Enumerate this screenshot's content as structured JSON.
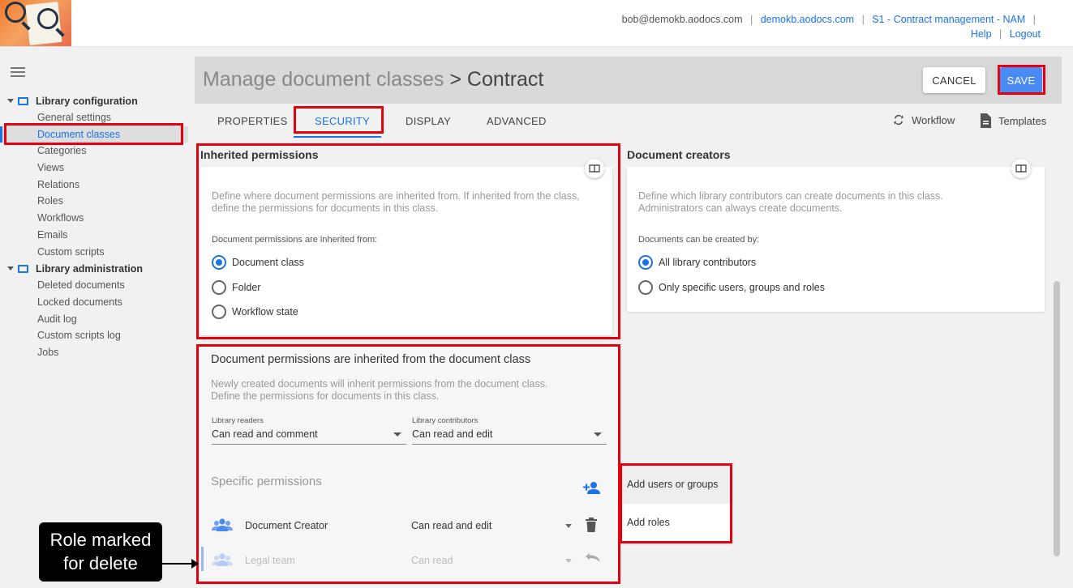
{
  "header": {
    "user_email": "bob@demokb.aodocs.com",
    "domain": "demokb.aodocs.com",
    "library": "S1 - Contract management - NAM",
    "help": "Help",
    "logout": "Logout"
  },
  "sidebar": {
    "groups": [
      {
        "label": "Library configuration",
        "items": [
          "General settings",
          "Document classes",
          "Categories",
          "Views",
          "Relations",
          "Roles",
          "Workflows",
          "Emails",
          "Custom scripts"
        ]
      },
      {
        "label": "Library administration",
        "items": [
          "Deleted documents",
          "Locked documents",
          "Audit log",
          "Custom scripts log",
          "Jobs"
        ]
      }
    ],
    "active_item": "Document classes"
  },
  "page": {
    "title": "Manage document classes",
    "current": "> Contract",
    "cancel_label": "CANCEL",
    "save_label": "SAVE"
  },
  "tabs": [
    "PROPERTIES",
    "SECURITY",
    "DISPLAY",
    "ADVANCED"
  ],
  "active_tab": "SECURITY",
  "tools": {
    "workflow": "Workflow",
    "templates": "Templates"
  },
  "inherited": {
    "title": "Inherited permissions",
    "help": [
      "Define where document permissions are inherited from. If inherited from the class,",
      "define the permissions for documents in this class."
    ],
    "label": "Document permissions are inherited from:",
    "options": [
      "Document class",
      "Folder",
      "Workflow state"
    ],
    "selected": "Document class"
  },
  "creators": {
    "title": "Document creators",
    "help": [
      "Define which library contributors can create documents in this class.",
      "Administrators can always create documents."
    ],
    "label": "Documents can be created by:",
    "options": [
      "All library contributors",
      "Only specific users, groups and roles"
    ],
    "selected": "All library contributors"
  },
  "class_perms": {
    "title": "Document permissions are inherited from the document class",
    "help": [
      "Newly created documents will inherit permissions from the document class.",
      "Define the permissions for documents in this class."
    ],
    "readers_label": "Library readers",
    "readers_value": "Can read and comment",
    "contributors_label": "Library contributors",
    "contributors_value": "Can read and edit",
    "specific_title": "Specific permissions",
    "rows": [
      {
        "name": "Document Creator",
        "level": "Can read and edit",
        "action": "delete"
      },
      {
        "name": "Legal team",
        "level": "Can read",
        "action": "undo",
        "marked_for_delete": true
      }
    ]
  },
  "add_menu": {
    "items": [
      "Add users or groups",
      "Add roles"
    ]
  },
  "callout": {
    "line1": "Role marked",
    "line2": "for delete"
  },
  "colors": {
    "accent": "#1a73e8",
    "save": "#4a8af4",
    "highlight": "#e3000f"
  }
}
